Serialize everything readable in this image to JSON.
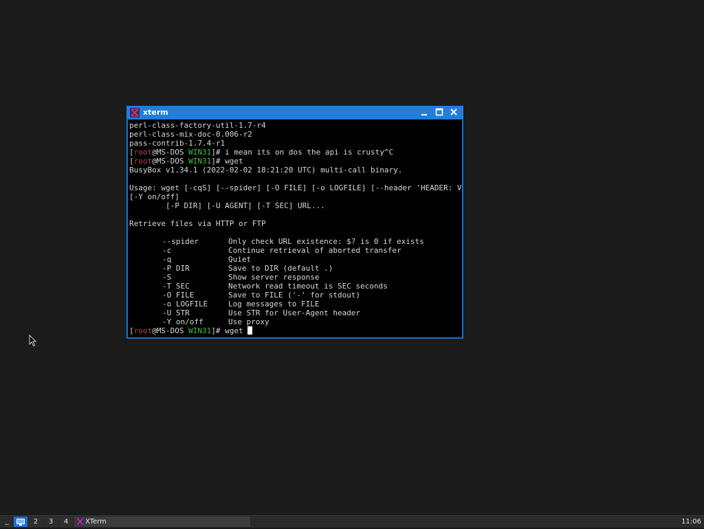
{
  "window": {
    "title": "xterm"
  },
  "terminal": {
    "prompt": {
      "open": "[",
      "user": "root",
      "at": "@",
      "host": "MS-DOS",
      "space": " ",
      "dir": "WIN31",
      "close": "]#"
    },
    "lines_before": [
      "perl-class-factory-util-1.7-r4",
      "perl-class-mix-doc-0.006-r2",
      "pass-contrib-1.7.4-r1"
    ],
    "command1": " i mean its on dos the api is crusty^C",
    "command2": " wget",
    "output": [
      "BusyBox v1.34.1 (2022-02-02 18:21:20 UTC) multi-call binary.",
      "",
      "Usage: wget [-cqS] [--spider] [-O FILE] [-o LOGFILE] [--header 'HEADER: VALUE']",
      "[-Y on/off]",
      "        [-P DIR] [-U AGENT] [-T SEC] URL...",
      "",
      "Retrieve files via HTTP or FTP",
      ""
    ],
    "options": [
      {
        "flag": "--spider",
        "desc": "Only check URL existence: $? is 0 if exists"
      },
      {
        "flag": "-c",
        "desc": "Continue retrieval of aborted transfer"
      },
      {
        "flag": "-q",
        "desc": "Quiet"
      },
      {
        "flag": "-P DIR",
        "desc": "Save to DIR (default .)"
      },
      {
        "flag": "-S",
        "desc": "Show server response"
      },
      {
        "flag": "-T SEC",
        "desc": "Network read timeout is SEC seconds"
      },
      {
        "flag": "-O FILE",
        "desc": "Save to FILE ('-' for stdout)"
      },
      {
        "flag": "-o LOGFILE",
        "desc": "Log messages to FILE"
      },
      {
        "flag": "-U STR",
        "desc": "Use STR for User-Agent header"
      },
      {
        "flag": "-Y on/off",
        "desc": "Use proxy"
      }
    ],
    "current_input": " wget "
  },
  "taskbar": {
    "menu_label": "_",
    "workspaces": [
      "1",
      "2",
      "3",
      "4"
    ],
    "task_label": "XTerm",
    "clock": "11:06"
  },
  "colors": {
    "titlebar": "#1f7fdb",
    "prompt_user": "#c84040",
    "prompt_dir": "#3fbf3f",
    "active_workspace": "#1f6fc9"
  }
}
